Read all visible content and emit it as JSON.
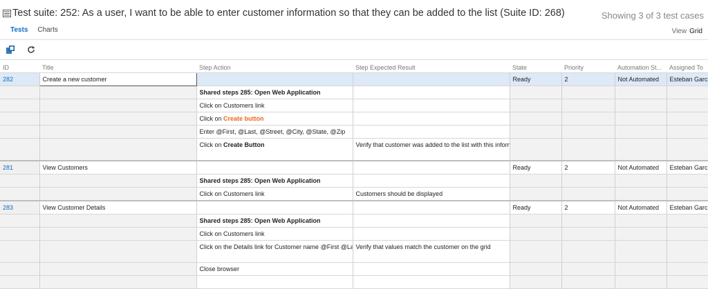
{
  "header": {
    "suite_title": "Test suite: 252: As a user, I want to be able to enter customer information so that they can be added to the list (Suite ID: 268)",
    "showing": "Showing 3 of 3 test cases"
  },
  "tabs": [
    {
      "label": "Tests",
      "active": true
    },
    {
      "label": "Charts",
      "active": false
    }
  ],
  "view_switch": {
    "label": "View",
    "value": "Grid"
  },
  "toolbar": {
    "icons": [
      "open-in-client-icon",
      "refresh-icon"
    ]
  },
  "columns": [
    "ID",
    "Title",
    "Step Action",
    "Step Expected Result",
    "State",
    "Priority",
    "Automation St...",
    "Assigned To"
  ],
  "tests": [
    {
      "id": "282",
      "title": "Create a new customer",
      "state": "Ready",
      "priority": "2",
      "automation": "Not Automated",
      "assigned": "Esteban Garcia",
      "steps": [
        {
          "action": "Shared steps 285: Open Web Application",
          "expected": ""
        },
        {
          "action": "Click on Customers link",
          "expected": ""
        },
        {
          "action_prefix": "Click on ",
          "action_em": "Create button",
          "expected": ""
        },
        {
          "action": "Enter @First, @Last, @Street, @City, @State, @Zip",
          "expected": ""
        },
        {
          "action_prefix": "Click on ",
          "action_bold": "Create Button",
          "expected": "Verify that customer was added to the list with this information: First: @First, Last: @Last, Street: @Street"
        }
      ]
    },
    {
      "id": "281",
      "title": "View Customers",
      "state": "Ready",
      "priority": "2",
      "automation": "Not Automated",
      "assigned": "Esteban Garcia",
      "steps": [
        {
          "action": "Shared steps 285: Open Web Application",
          "expected": ""
        },
        {
          "action": "Click on Customers link",
          "expected": "Customers should be displayed"
        }
      ]
    },
    {
      "id": "283",
      "title": "View Customer Details",
      "state": "Ready",
      "priority": "2",
      "automation": "Not Automated",
      "assigned": "Esteban Garcia",
      "steps": [
        {
          "action": "Shared steps 285: Open Web Application",
          "expected": ""
        },
        {
          "action": "Click on Customers link",
          "expected": ""
        },
        {
          "action": "Click on the Details link for Customer name @First @Last",
          "expected": "Verify that values match the customer on the grid"
        },
        {
          "action": "Close browser",
          "expected": ""
        }
      ]
    }
  ]
}
